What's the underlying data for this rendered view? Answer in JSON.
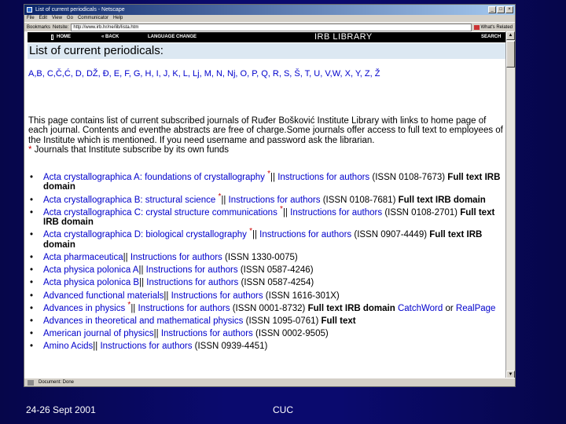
{
  "window": {
    "title": "List of current periodicals - Netscape",
    "buttons": [
      "_",
      "□",
      "×"
    ]
  },
  "menu": [
    "File",
    "Edit",
    "View",
    "Go",
    "Communicator",
    "Help"
  ],
  "location_bar": {
    "bookmarks_label": "Bookmarks",
    "netsite_label": "Netsite:",
    "url": "http://www.irb.hr/ne/lib/lista.htm",
    "related_label": "What's Related"
  },
  "page": {
    "nav": {
      "home": "HOME",
      "back": "« BACK",
      "language": "LANGUAGE CHANGE",
      "brand": "IRB LIBRARY",
      "search": "SEARCH"
    },
    "heading": "List of current periodicals:",
    "alphabet": "A,B, C,Č,Ć, D, DŽ, Đ, E, F, G, H, I, J, K, L, Lj, M, N, Nj, O, P, Q, R, S, Š, T, U, V,W, X, Y, Z, Ž",
    "intro": "This page contains list of current subscribed journals of Ruđer Bošković Institute Library with links to home page of each journal. Contents and eventhe abstracts are free of charge.Some journals offer access to full text to employees of the Institute which is mentioned. If you need username and password ask the librarian.",
    "footnote_star": "*",
    "footnote_text": " Journals that Institute subscribe by its own funds",
    "journals": [
      {
        "title": "Acta crystallographica A: foundations of crystallography",
        "star": "*",
        "sep": "||",
        "instr": "Instructions for authors",
        "issn": "(ISSN 0108-7673)",
        "ft": "Full text IRB domain"
      },
      {
        "title": "Acta crystallographica B: structural science",
        "star": "*",
        "sep": "||",
        "instr": "Instructions for authors",
        "issn": "(ISSN 0108-7681)",
        "ft": "Full text IRB domain"
      },
      {
        "title": "Acta crystallographica C: crystal structure communications",
        "star": "*",
        "sep": "||",
        "instr": "Instructions for authors",
        "issn": "(ISSN 0108-2701)",
        "ft": "Full text IRB domain"
      },
      {
        "title": "Acta crystallographica D: biological crystallography",
        "star": "*",
        "sep": "||",
        "instr": "Instructions for authors",
        "issn": "(ISSN 0907-4449)",
        "ft": "Full text IRB domain"
      },
      {
        "title": "Acta pharmaceutica",
        "sep": "||",
        "instr": "Instructions for authors",
        "issn": "(ISSN 1330-0075)"
      },
      {
        "title": "Acta physica polonica A",
        "sep": "||",
        "instr": "Instructions for authors",
        "issn": "(ISSN 0587-4246)"
      },
      {
        "title": "Acta physica polonica B",
        "sep": "||",
        "instr": "Instructions for authors",
        "issn": "(ISSN 0587-4254)"
      },
      {
        "title": "Advanced functional materials",
        "sep": "||",
        "instr": "Instructions for authors",
        "issn": "(ISSN 1616-301X)"
      },
      {
        "title": "Advances in physics",
        "star": "*",
        "sep": "||",
        "instr": "Instructions for authors",
        "issn": "(ISSN 0001-8732)",
        "ft": "Full text IRB domain",
        "extra1": "CatchWord",
        "or": "or",
        "extra2": "RealPage"
      },
      {
        "title": "Advances in theoretical and mathematical physics",
        "issn": "(ISSN 1095-0761)",
        "ft": "Full text"
      },
      {
        "title": "American journal of physics",
        "sep": "||",
        "instr": "Instructions for authors",
        "issn": "(ISSN 0002-9505)"
      },
      {
        "title": "Amino Acids",
        "sep": "||",
        "instr": "Instructions for authors",
        "issn": "(ISSN 0939-4451)"
      }
    ]
  },
  "status_bar": "Document: Done",
  "slide_footer": {
    "date": "24-26 Sept 2001",
    "center": "CUC"
  }
}
